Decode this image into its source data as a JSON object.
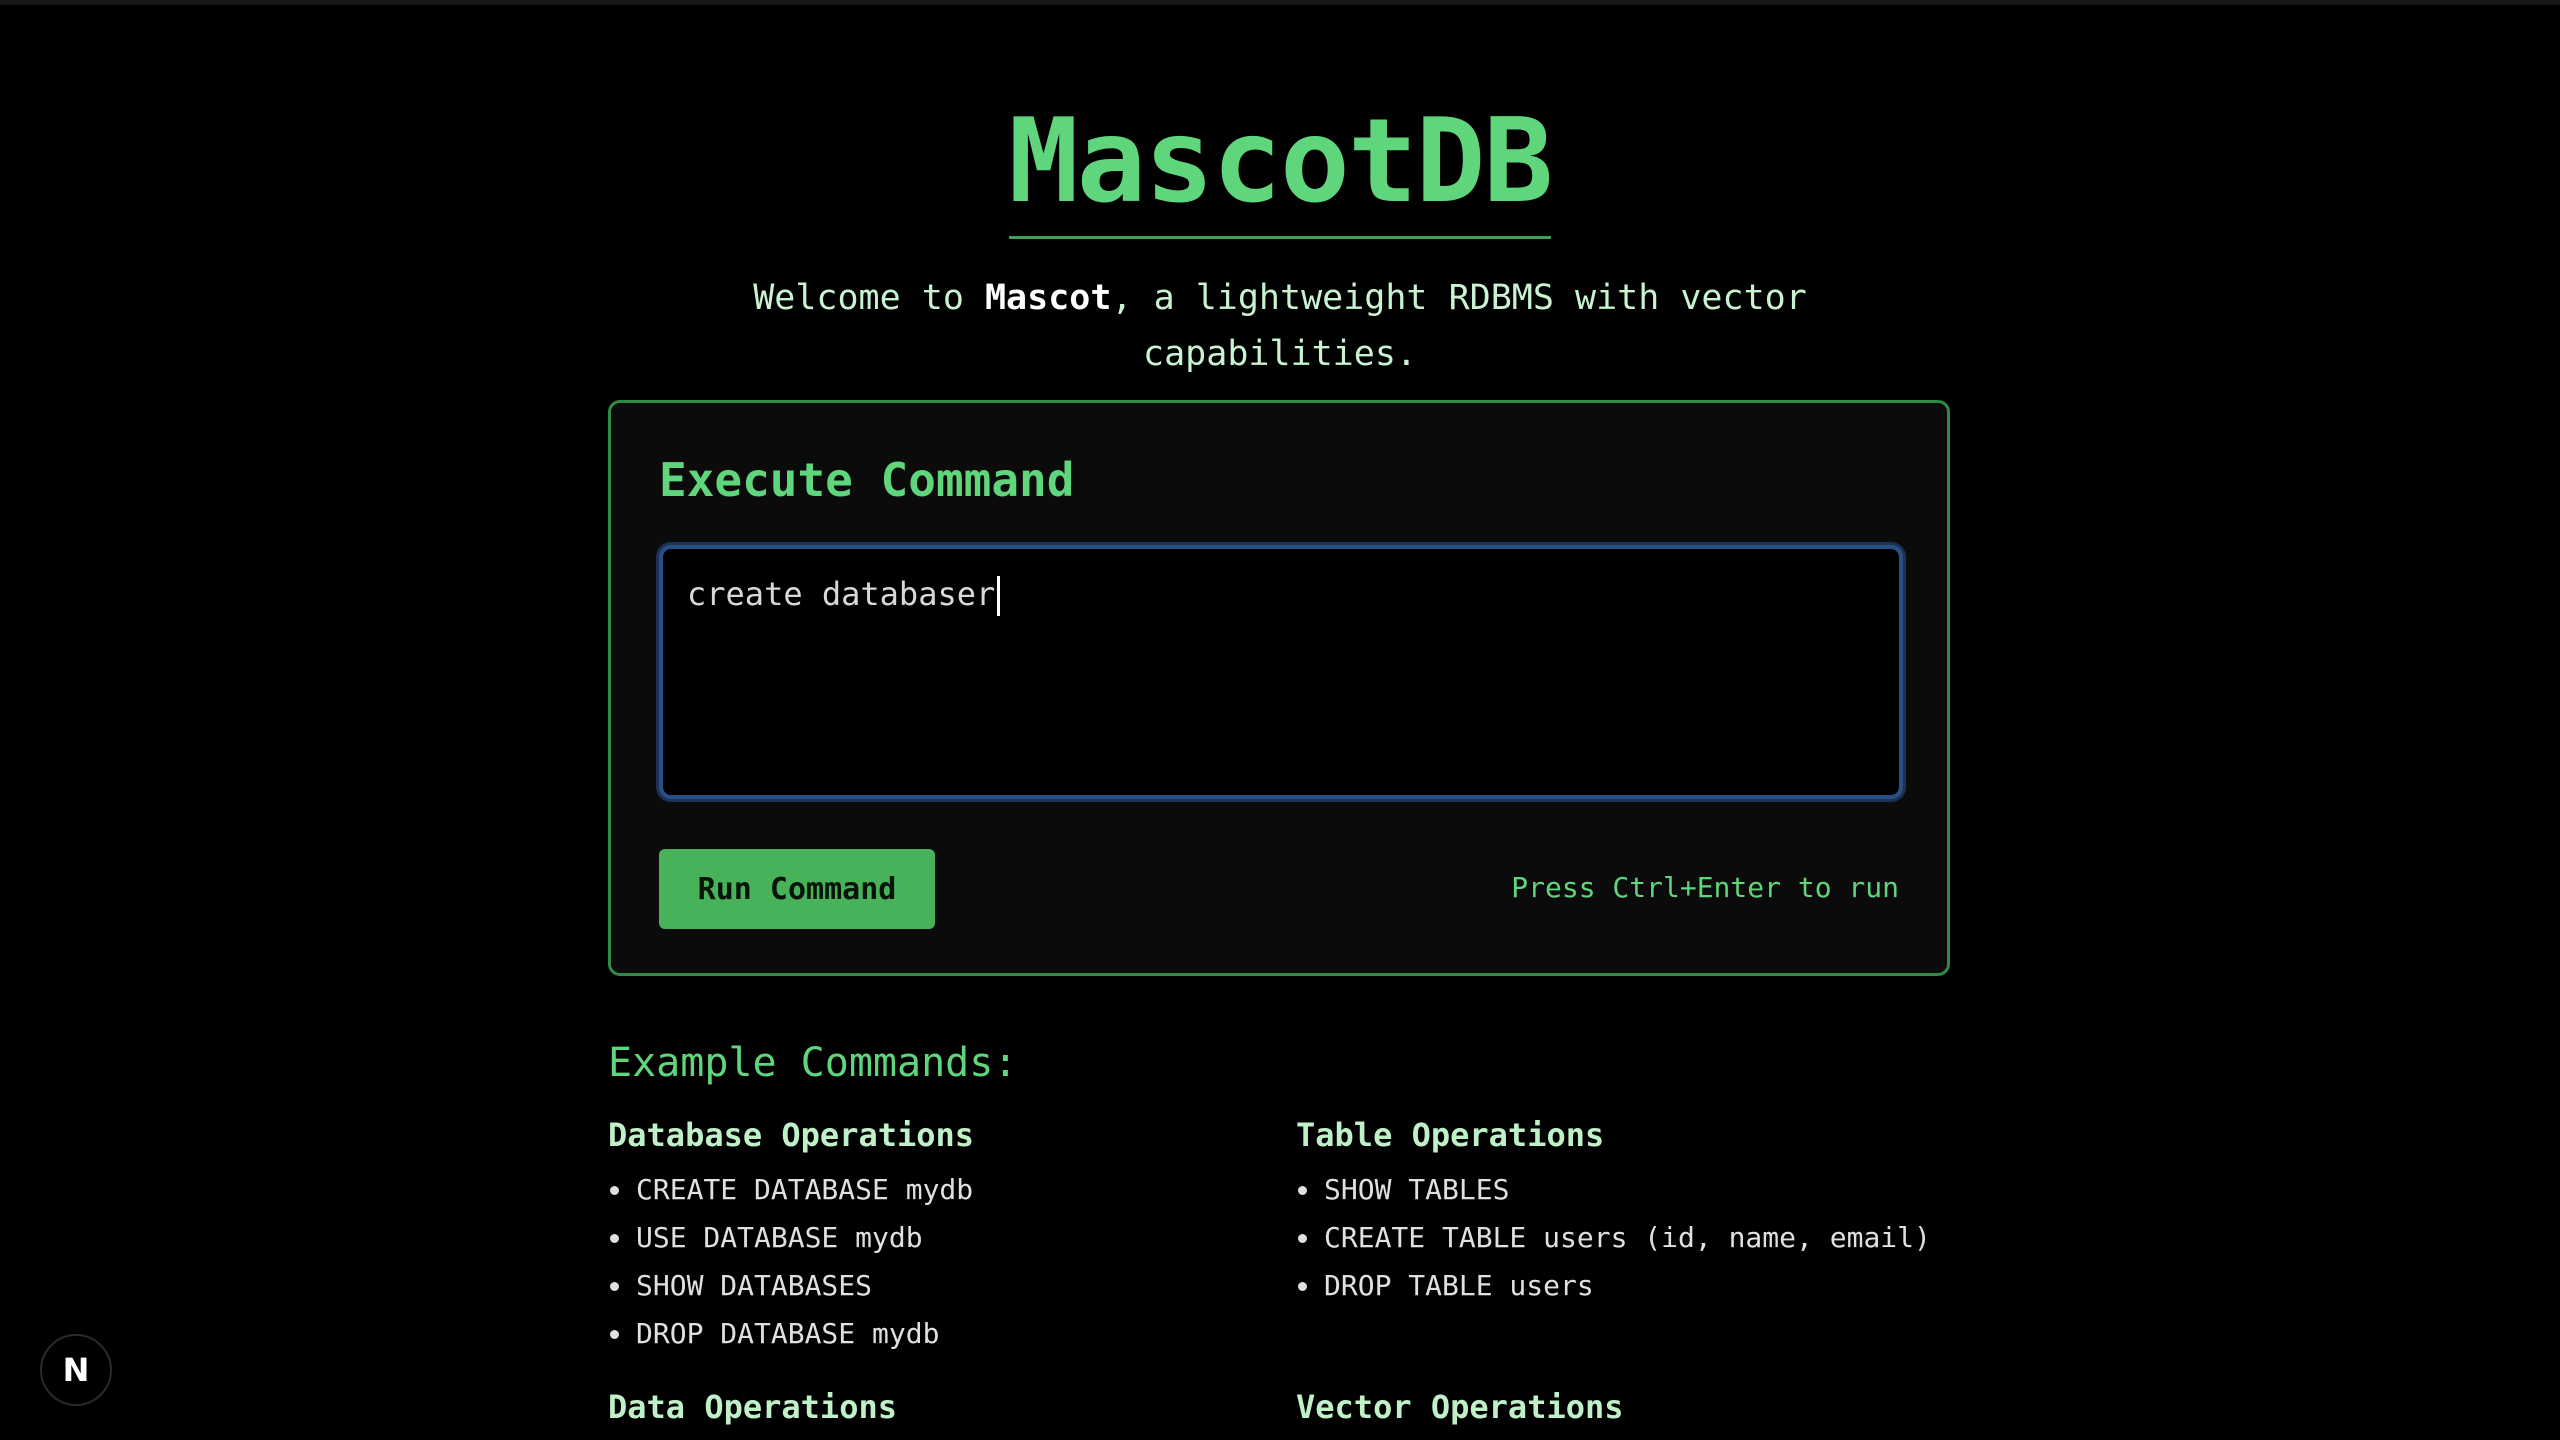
{
  "header": {
    "title": "MascotDB",
    "subtitle_prefix": "Welcome to ",
    "subtitle_brand": "Mascot",
    "subtitle_suffix": ", a lightweight RDBMS with vector capabilities."
  },
  "execute": {
    "heading": "Execute Command",
    "command_value": "create databaser",
    "run_label": "Run Command",
    "hint": "Press Ctrl+Enter to run"
  },
  "examples": {
    "heading": "Example Commands:",
    "groups": [
      {
        "title": "Database Operations",
        "items": [
          "CREATE DATABASE mydb",
          "USE DATABASE mydb",
          "SHOW DATABASES",
          "DROP DATABASE mydb"
        ]
      },
      {
        "title": "Table Operations",
        "items": [
          "SHOW TABLES",
          "CREATE TABLE users (id, name, email)",
          "DROP TABLE users"
        ]
      },
      {
        "title": "Data Operations",
        "items": []
      },
      {
        "title": "Vector Operations",
        "items": []
      }
    ]
  },
  "badge": {
    "letter": "N",
    "icon": "nextjs-icon"
  },
  "colors": {
    "accent": "#5fd57c",
    "button": "#48b25a",
    "background": "#000000",
    "input_border": "#2a4f86"
  }
}
